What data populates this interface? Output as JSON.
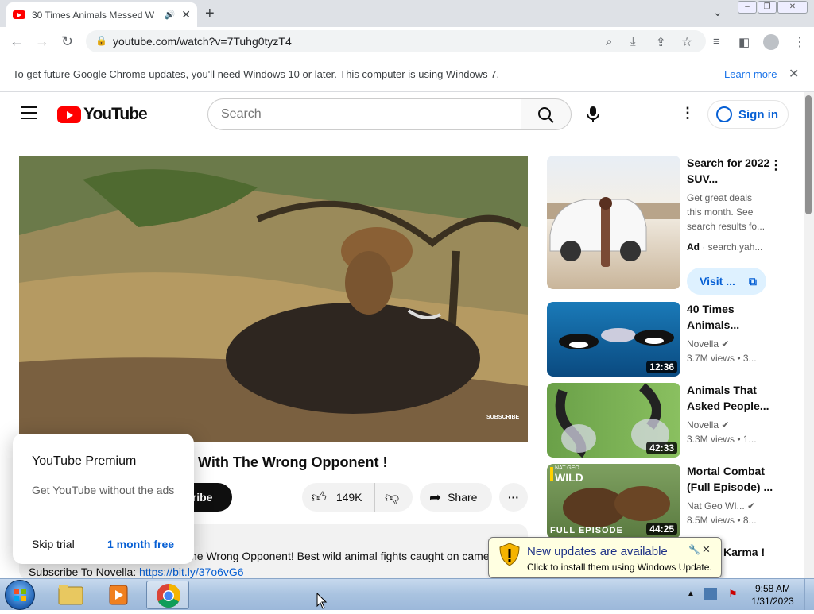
{
  "browser": {
    "tab_title": "30 Times Animals Messed W",
    "new_tab": "+",
    "url": "youtube.com/watch?v=7Tuhg0tyzT4",
    "infobar_text": "To get future Google Chrome updates, you'll need Windows 10 or later. This computer is using Windows 7.",
    "learn_more": "Learn more"
  },
  "youtube": {
    "logo_text": "YouTube",
    "search_placeholder": "Search",
    "sign_in": "Sign in",
    "video_title_visible": "With The Wrong Opponent !",
    "subscribe_partial": "cribe",
    "likes": "149K",
    "share": "Share",
    "description_line1": "he Wrong Opponent! Best wild animal fights caught on came",
    "description_line2_prefix": "Subscribe To Novella: ",
    "description_link": "https://bit.ly/37o6vG6",
    "video_watermark": "SUBSCRIBE"
  },
  "premium_popup": {
    "title": "YouTube Premium",
    "subtitle": "Get YouTube without the ads",
    "skip": "Skip trial",
    "cta": "1 month free"
  },
  "sidebar": {
    "ad": {
      "title": "Search for 2022 SUV...",
      "desc": "Get great deals this month. See search results fo...",
      "ad_label": "Ad",
      "domain": "search.yah...",
      "visit": "Visit ..."
    },
    "items": [
      {
        "title": "40 Times Animals...",
        "channel": "Novella",
        "meta": "3.7M views • 3...",
        "duration": "12:36"
      },
      {
        "title": "Animals That Asked People...",
        "channel": "Novella",
        "meta": "3.3M views • 1...",
        "duration": "42:33"
      },
      {
        "title": "Mortal Combat (Full Episode) ...",
        "channel": "Nat Geo WI...",
        "meta": "8.5M views • 8...",
        "duration": "44:25",
        "thumb_badge": "WILD",
        "thumb_badge_top": "NAT GEO",
        "thumb_caption": "FULL EPISODE"
      },
      {
        "title": "Karma !",
        "channel": "",
        "meta": "",
        "duration": ""
      }
    ]
  },
  "windows_update": {
    "title": "New updates are available",
    "body": "Click to install them using Windows Update."
  },
  "taskbar": {
    "time": "9:58 AM",
    "date": "1/31/2023"
  },
  "colors": {
    "youtube_red": "#ff0000",
    "link_blue": "#065fd4",
    "chrome_blue": "#1a73e8",
    "taskbar": "#a9c3e0"
  }
}
